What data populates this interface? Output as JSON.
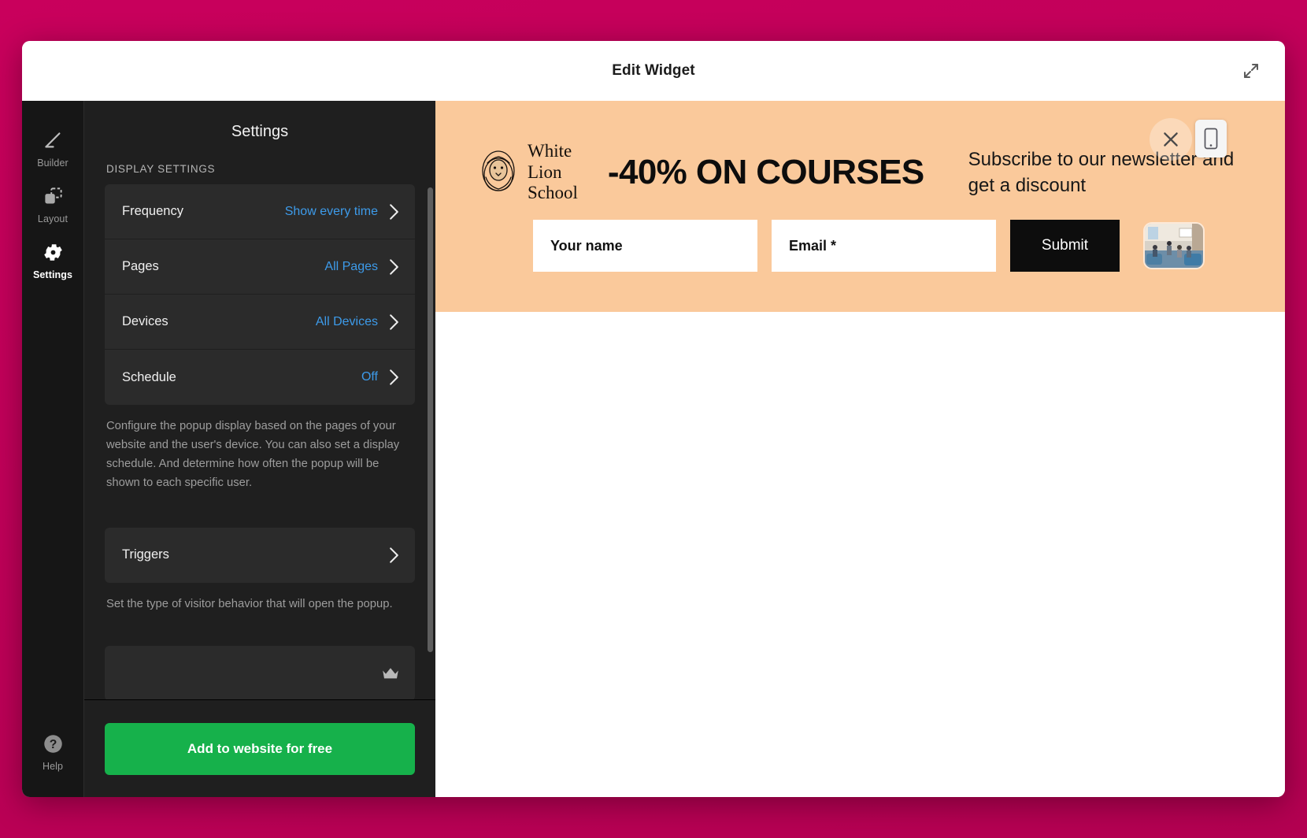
{
  "window": {
    "title": "Edit Widget",
    "expand_icon": "expand-arrows-icon"
  },
  "rail": {
    "items": [
      {
        "id": "builder",
        "label": "Builder",
        "icon": "pencil-icon",
        "active": false
      },
      {
        "id": "layout",
        "label": "Layout",
        "icon": "layout-icon",
        "active": false
      },
      {
        "id": "settings",
        "label": "Settings",
        "icon": "gear-icon",
        "active": true
      }
    ],
    "help": {
      "label": "Help",
      "icon": "question-circle-icon"
    }
  },
  "settings": {
    "title": "Settings",
    "section_label": "DISPLAY SETTINGS",
    "display_rows": [
      {
        "label": "Frequency",
        "value": "Show every time"
      },
      {
        "label": "Pages",
        "value": "All Pages"
      },
      {
        "label": "Devices",
        "value": "All Devices"
      },
      {
        "label": "Schedule",
        "value": "Off"
      }
    ],
    "display_help": "Configure the popup display based on the pages of your website and the user's device. You can also set a display schedule. And determine how often the popup will be shown to each specific user.",
    "triggers_row": {
      "label": "Triggers",
      "value": ""
    },
    "triggers_help": "Set the type of visitor behavior that will open the popup.",
    "premium_row": {
      "label": "",
      "icon": "crown-icon"
    },
    "cta_label": "Add to website for free",
    "cta_color": "#16b14b",
    "value_color": "#3d9bea"
  },
  "preview": {
    "background": "#fac99b",
    "brand": {
      "line1": "White Lion",
      "line2": "School",
      "icon": "lion-head-icon"
    },
    "headline": "-40% ON COURSES",
    "subtext": "Subscribe to our newsletter and get a discount",
    "fields": [
      {
        "name": "your-name",
        "placeholder": "Your name",
        "value": ""
      },
      {
        "name": "email",
        "placeholder": "Email *",
        "value": ""
      }
    ],
    "submit_label": "Submit",
    "thumbnail_alt": "classroom-photo",
    "close_icon": "close-icon",
    "device_icon": "mobile-device-icon"
  }
}
